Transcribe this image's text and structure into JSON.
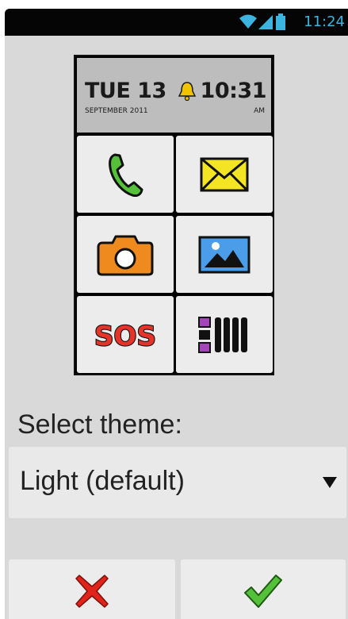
{
  "status_bar": {
    "time": "11:24",
    "icons": [
      "wifi-icon",
      "signal-icon",
      "battery-icon"
    ]
  },
  "preview": {
    "day_date": "TUE 13",
    "month_year": "SEPTEMBER 2011",
    "time": "10:31",
    "ampm": "AM",
    "tiles": [
      {
        "icon": "phone-icon",
        "color": "#55c03a"
      },
      {
        "icon": "envelope-icon",
        "color": "#f3e524"
      },
      {
        "icon": "camera-icon",
        "color": "#ef8a1e"
      },
      {
        "icon": "picture-icon",
        "color": "#4b9de9"
      },
      {
        "icon": "sos-icon",
        "label": "SOS",
        "color": "#e5332a"
      },
      {
        "icon": "app-grid-icon",
        "color": "#a347b8"
      }
    ]
  },
  "theme": {
    "label": "Select theme:",
    "selected": "Light (default)"
  },
  "actions": {
    "cancel_icon": "cross-icon",
    "confirm_icon": "checkmark-icon",
    "cancel_color": "#e0241b",
    "confirm_color": "#55c03a"
  }
}
